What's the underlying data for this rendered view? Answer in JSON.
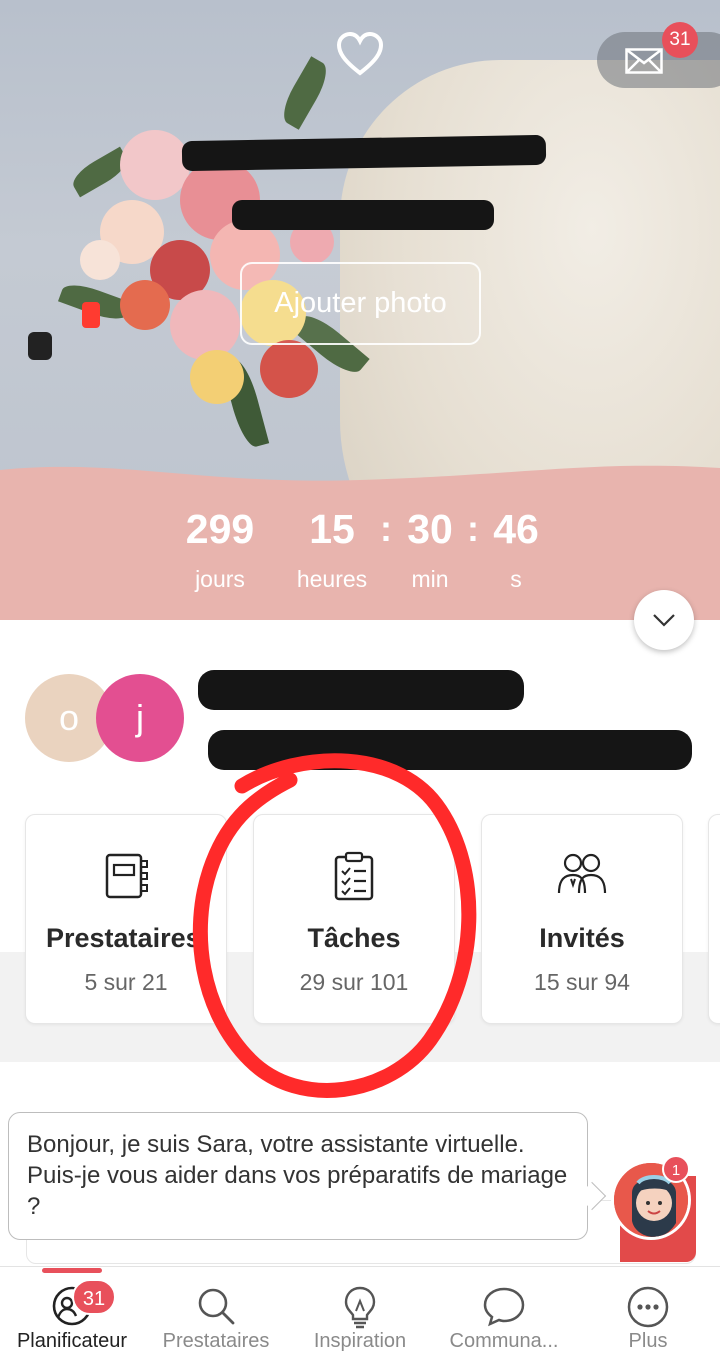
{
  "header": {
    "add_photo_label": "Ajouter photo",
    "mail_badge": "31"
  },
  "countdown": {
    "days": "299",
    "days_label": "jours",
    "hours": "15",
    "hours_label": "heures",
    "minutes": "30",
    "minutes_label": "min",
    "seconds": "46",
    "seconds_label": "s",
    "separator": ":"
  },
  "couple": {
    "initial_1": "o",
    "initial_2": "j"
  },
  "cards": [
    {
      "title": "Prestataires",
      "subtitle": "5 sur 21",
      "icon": "notebook-icon"
    },
    {
      "title": "Tâches",
      "subtitle": "29 sur 101",
      "icon": "checklist-icon"
    },
    {
      "title": "Invités",
      "subtitle": "15 sur 94",
      "icon": "guests-icon"
    }
  ],
  "assistant": {
    "message": "Bonjour, je suis Sara, votre assistante virtuelle. Puis-je vous aider dans vos préparatifs de mariage ?",
    "badge": "1"
  },
  "nav": {
    "items": [
      {
        "label": "Planificateur",
        "icon": "planner-icon",
        "badge": "31"
      },
      {
        "label": "Prestataires",
        "icon": "search-icon"
      },
      {
        "label": "Inspiration",
        "icon": "lightbulb-icon"
      },
      {
        "label": "Communa...",
        "icon": "chat-bubble-icon"
      },
      {
        "label": "Plus",
        "icon": "more-icon"
      }
    ]
  },
  "colors": {
    "accent": "#e8505b",
    "pink_band": "#e8b4ae",
    "annotation": "#ff2a2a"
  }
}
